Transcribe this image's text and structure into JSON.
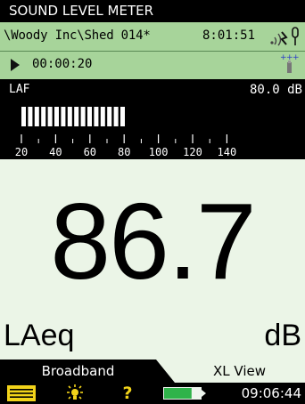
{
  "app": {
    "title": "SOUND LEVEL METER"
  },
  "status": {
    "project_path": "\\Woody Inc\\Shed 014*",
    "clock": "8:01:51",
    "elapsed": "00:00:20",
    "icons": [
      "signal-icon",
      "microphone-icon",
      "play-icon",
      "trigger-icon"
    ]
  },
  "bar": {
    "parameter": "LAF",
    "reading": "80.0 dB",
    "level_db": 80.0,
    "scale_min": 20,
    "scale_max": 145,
    "ticks": [
      "20",
      "40",
      "60",
      "80",
      "100",
      "120",
      "140"
    ]
  },
  "main": {
    "value": "86.7",
    "parameter": "LAeq",
    "unit": "dB"
  },
  "tabs": [
    {
      "label": "Broadband",
      "active": true
    },
    {
      "label": "XL View",
      "active": false
    }
  ],
  "footer": {
    "time": "09:06:44",
    "help_label": "?",
    "battery_charge": 0.75,
    "icons": [
      "menu-icon",
      "backlight-icon",
      "help-icon",
      "battery-icon"
    ]
  },
  "colors": {
    "status_green": "#a7d49a",
    "main_bg": "#ebf5e7",
    "accent_yellow": "#f2d31a",
    "battery_green": "#2fb34a"
  }
}
